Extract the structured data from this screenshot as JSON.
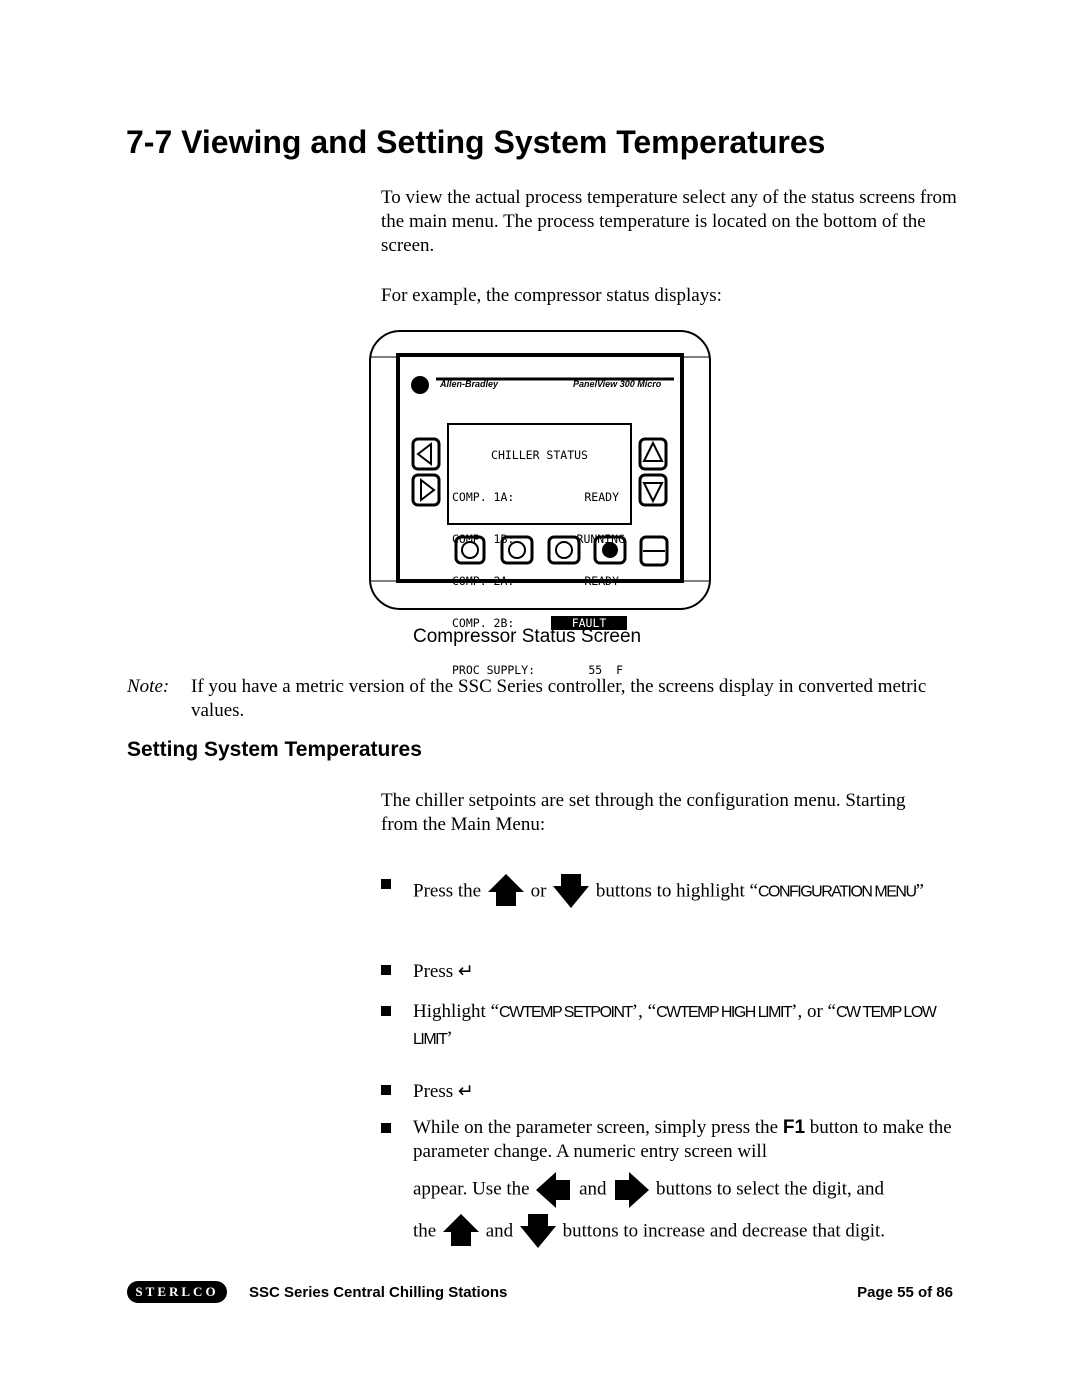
{
  "title": "7-7 Viewing and Setting System Temperatures",
  "intro": "To view the actual process temperature select any of the status screens from the main menu. The process temperature is located on the bottom of the screen.",
  "example": "For example, the compressor status displays:",
  "device": {
    "brand_left": "Allen-Bradley",
    "brand_right": "PanelView 300 Micro",
    "screen_title": "CHILLER STATUS",
    "rows": [
      {
        "label": "COMP. 1A:",
        "value": "READY"
      },
      {
        "label": "COMP. 1B:",
        "value": "RUNNING"
      },
      {
        "label": "COMP. 2A:",
        "value": "READY"
      },
      {
        "label": "COMP. 2B:",
        "value": "FAULT",
        "highlighted": true
      }
    ],
    "supply_label": "PROC SUPPLY:",
    "supply_value": "55  F",
    "fkeys": [
      "F1",
      "F2",
      "F3",
      "F4"
    ]
  },
  "caption": "Compressor Status Screen",
  "note": {
    "label": "Note:",
    "text": "If you have a metric version of the SSC Series controller, the screens display in converted metric values."
  },
  "subheading": "Setting System Temperatures",
  "setpoint_intro": "The chiller setpoints are set through the configuration menu. Starting from the Main Menu:",
  "bullets": {
    "b1": {
      "a": "Press the",
      "b": "or",
      "c": "buttons to highlight “",
      "menu": "CONFIGURATION MENU",
      "d": "”"
    },
    "b2": {
      "a": "Press"
    },
    "b3": {
      "a": "Highlight “",
      "s1": "CWTEMP SETPOINT",
      "m1": "’, “",
      "s2": "CWTEMP HIGH LIMIT",
      "m2": "’, or “",
      "s3": "CW TEMP LOW LIMIT",
      "e": "’"
    },
    "b4": {
      "a": "Press"
    },
    "b5": {
      "a": "While on the parameter screen, simply press the",
      "key": "F1",
      "b": "button to make the parameter change.  A numeric entry screen will",
      "c": "appear.  Use the",
      "d": "and",
      "e": "buttons to select the digit, and",
      "f": "the",
      "g": "and",
      "h": "buttons to increase and decrease that digit."
    }
  },
  "footer": {
    "logo": "STERLCO",
    "title": "SSC Series Central Chilling Stations",
    "page": "Page 55 of 86"
  }
}
